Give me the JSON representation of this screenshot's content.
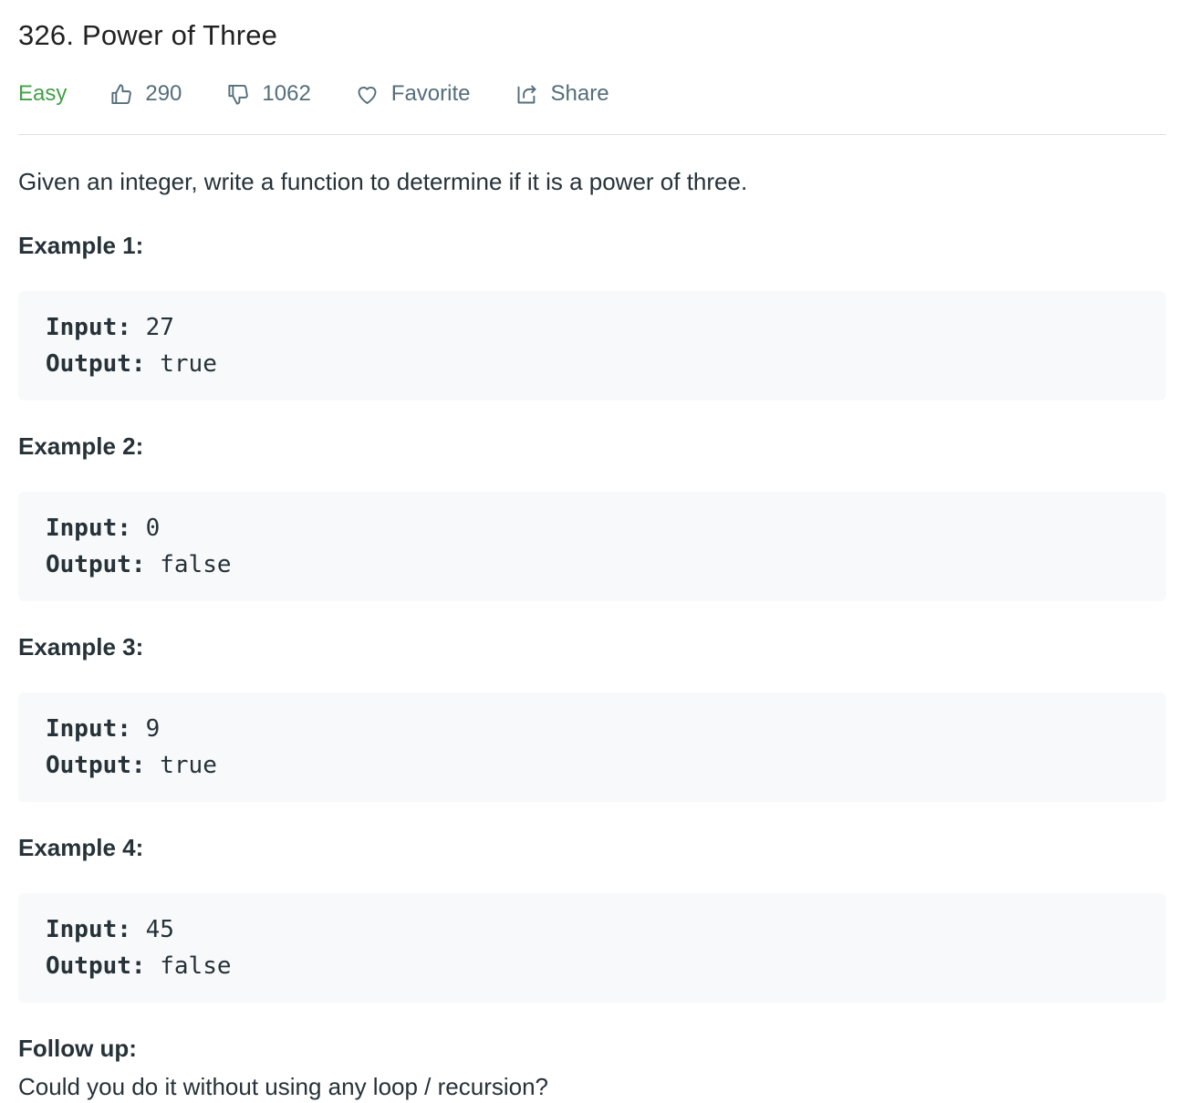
{
  "problem": {
    "title": "326. Power of Three",
    "difficulty": "Easy",
    "likes": "290",
    "dislikes": "1062",
    "favorite_label": "Favorite",
    "share_label": "Share",
    "description": "Given an integer, write a function to determine if it is a power of three."
  },
  "examples": [
    {
      "heading": "Example 1:",
      "input_label": "Input:",
      "input": "27",
      "output_label": "Output:",
      "output": "true"
    },
    {
      "heading": "Example 2:",
      "input_label": "Input:",
      "input": "0",
      "output_label": "Output:",
      "output": "false"
    },
    {
      "heading": "Example 3:",
      "input_label": "Input:",
      "input": "9",
      "output_label": "Output:",
      "output": "true"
    },
    {
      "heading": "Example 4:",
      "input_label": "Input:",
      "input": "45",
      "output_label": "Output:",
      "output": "false"
    }
  ],
  "follow_up": {
    "heading": "Follow up:",
    "text": "Could you do it without using any loop / recursion?"
  },
  "colors": {
    "difficulty_easy": "#43a047",
    "meta_text": "#546e7a",
    "code_bg": "#f7f9fa",
    "divider": "#e0e0e0"
  },
  "icons": {
    "like": "thumbs-up-icon",
    "dislike": "thumbs-down-icon",
    "favorite": "heart-icon",
    "share": "share-icon"
  }
}
